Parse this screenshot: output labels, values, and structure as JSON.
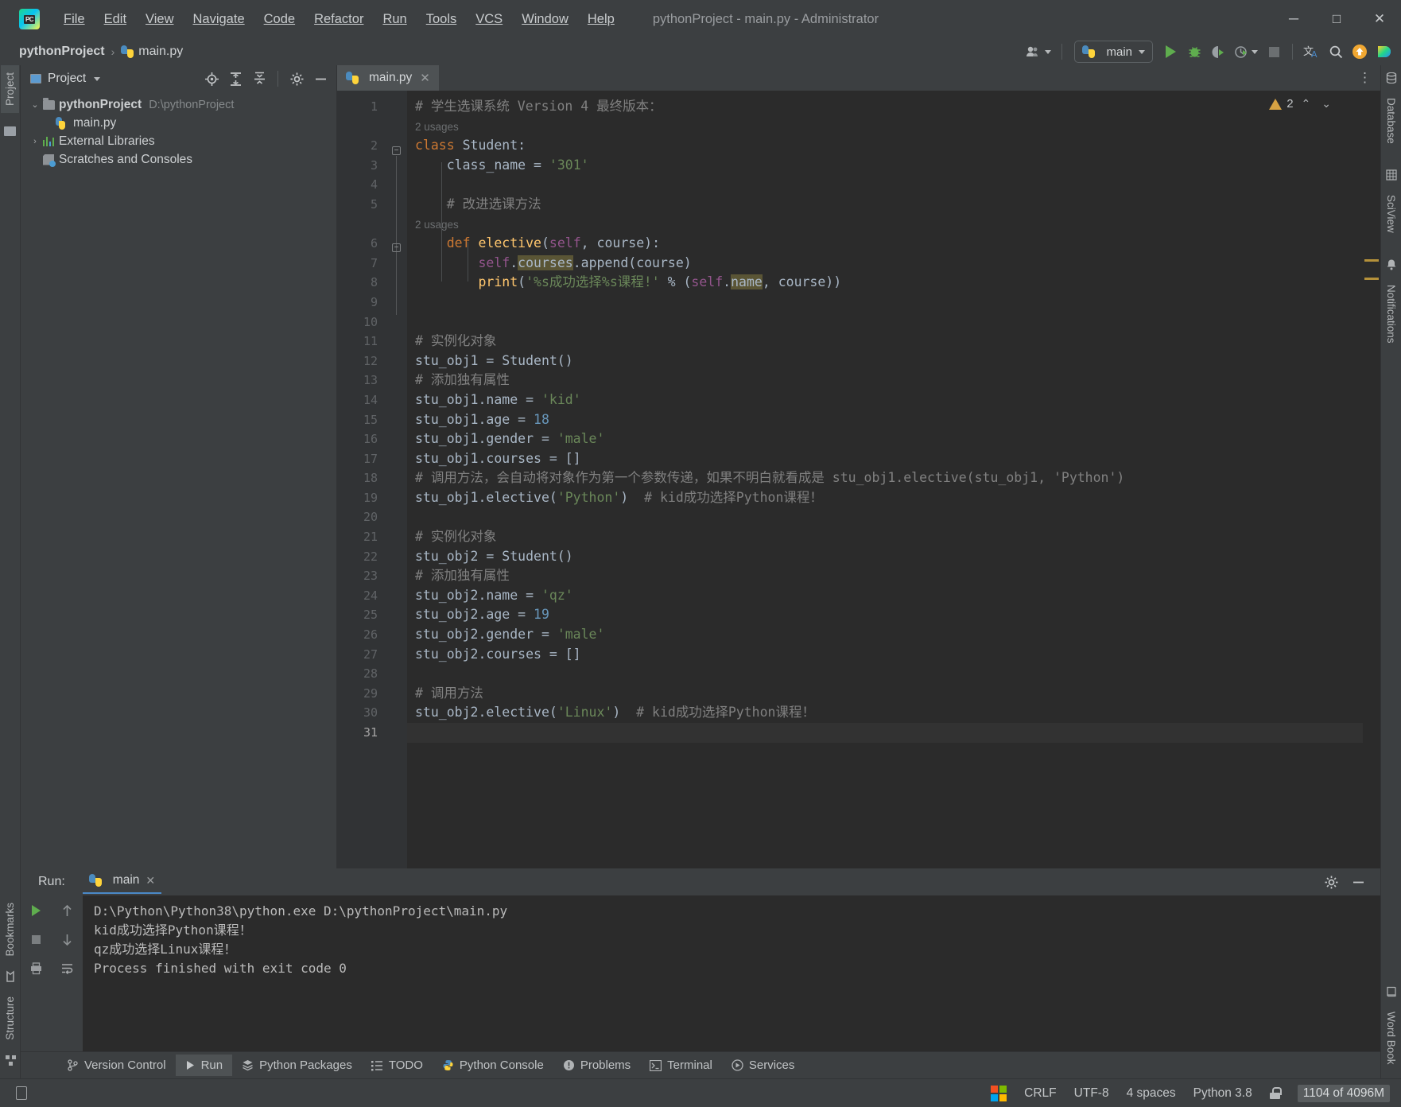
{
  "titlebar": {
    "app_icon": "pycharm-logo-icon",
    "menus": [
      "File",
      "Edit",
      "View",
      "Navigate",
      "Code",
      "Refactor",
      "Run",
      "Tools",
      "VCS",
      "Window",
      "Help"
    ],
    "window_title": "pythonProject - main.py - Administrator",
    "minimize": "─",
    "maximize": "□",
    "close": "✕"
  },
  "navbar": {
    "crumbs": [
      "pythonProject",
      "main.py"
    ],
    "separator": "›",
    "run_config": "main",
    "icons": [
      "user-dropdown-icon",
      "run-icon",
      "debug-icon",
      "coverage-icon",
      "profile-icon",
      "stop-icon",
      "translate-icon",
      "search-icon",
      "update-icon",
      "datalore-icon"
    ]
  },
  "left_strip": {
    "tabs": [
      "Project"
    ],
    "bottom_tabs": [
      "Bookmarks",
      "Structure"
    ]
  },
  "right_strip": {
    "tabs": [
      "Database",
      "SciView",
      "Notifications"
    ],
    "bottom_tabs": [
      "Word Book"
    ]
  },
  "project_panel": {
    "title": "Project",
    "header_icons": [
      "locate-icon",
      "expand-all-icon",
      "collapse-all-icon",
      "settings-icon",
      "hide-icon"
    ],
    "tree": [
      {
        "label": "pythonProject",
        "path": "D:\\pythonProject",
        "icon": "folder-icon",
        "depth": 0,
        "arrow": "⌄",
        "bold": true
      },
      {
        "label": "main.py",
        "path": "",
        "icon": "python-file-icon",
        "depth": 1,
        "arrow": "",
        "bold": false
      },
      {
        "label": "External Libraries",
        "path": "",
        "icon": "libraries-icon",
        "depth": 0,
        "arrow": "›",
        "bold": false
      },
      {
        "label": "Scratches and Consoles",
        "path": "",
        "icon": "scratches-icon",
        "depth": 0,
        "arrow": "",
        "bold": false
      }
    ]
  },
  "editor": {
    "tab": {
      "label": "main.py",
      "icon": "python-file-icon",
      "close": "✕"
    },
    "inspection_count": "2",
    "lines": [
      {
        "n": "1",
        "type": "code",
        "text": "# 学生选课系统 Version 4 最终版本："
      },
      {
        "n": "",
        "type": "usages",
        "text": "2 usages"
      },
      {
        "n": "2",
        "type": "code",
        "text": "class Student:"
      },
      {
        "n": "3",
        "type": "code",
        "text": "    class_name = '301'"
      },
      {
        "n": "4",
        "type": "code",
        "text": ""
      },
      {
        "n": "5",
        "type": "code",
        "text": "    # 改进选课方法"
      },
      {
        "n": "",
        "type": "usages",
        "text": "2 usages"
      },
      {
        "n": "6",
        "type": "code",
        "text": "    def elective(self, course):"
      },
      {
        "n": "7",
        "type": "code",
        "text": "        self.courses.append(course)"
      },
      {
        "n": "8",
        "type": "code",
        "text": "        print('%s成功选择%s课程!' % (self.name, course))"
      },
      {
        "n": "9",
        "type": "code",
        "text": ""
      },
      {
        "n": "10",
        "type": "code",
        "text": ""
      },
      {
        "n": "11",
        "type": "code",
        "text": "# 实例化对象"
      },
      {
        "n": "12",
        "type": "code",
        "text": "stu_obj1 = Student()"
      },
      {
        "n": "13",
        "type": "code",
        "text": "# 添加独有属性"
      },
      {
        "n": "14",
        "type": "code",
        "text": "stu_obj1.name = 'kid'"
      },
      {
        "n": "15",
        "type": "code",
        "text": "stu_obj1.age = 18"
      },
      {
        "n": "16",
        "type": "code",
        "text": "stu_obj1.gender = 'male'"
      },
      {
        "n": "17",
        "type": "code",
        "text": "stu_obj1.courses = []"
      },
      {
        "n": "18",
        "type": "code",
        "text": "# 调用方法，会自动将对象作为第一个参数传递，如果不明白就看成是 stu_obj1.elective(stu_obj1, 'Python')"
      },
      {
        "n": "19",
        "type": "code",
        "text": "stu_obj1.elective('Python')  # kid成功选择Python课程！"
      },
      {
        "n": "20",
        "type": "code",
        "text": ""
      },
      {
        "n": "21",
        "type": "code",
        "text": "# 实例化对象"
      },
      {
        "n": "22",
        "type": "code",
        "text": "stu_obj2 = Student()"
      },
      {
        "n": "23",
        "type": "code",
        "text": "# 添加独有属性"
      },
      {
        "n": "24",
        "type": "code",
        "text": "stu_obj2.name = 'qz'"
      },
      {
        "n": "25",
        "type": "code",
        "text": "stu_obj2.age = 19"
      },
      {
        "n": "26",
        "type": "code",
        "text": "stu_obj2.gender = 'male'"
      },
      {
        "n": "27",
        "type": "code",
        "text": "stu_obj2.courses = []"
      },
      {
        "n": "28",
        "type": "code",
        "text": ""
      },
      {
        "n": "29",
        "type": "code",
        "text": "# 调用方法"
      },
      {
        "n": "30",
        "type": "code",
        "text": "stu_obj2.elective('Linux')  # kid成功选择Python课程！"
      },
      {
        "n": "31",
        "type": "code",
        "text": ""
      }
    ]
  },
  "run_panel": {
    "label": "Run:",
    "tab": "main",
    "tab_close": "✕",
    "side_icons": [
      "rerun-icon",
      "up-icon",
      "down-icon",
      "settings-wrench-icon",
      "stop-icon",
      "soft-wrap-icon",
      "print-icon"
    ],
    "header_icons": [
      "settings-icon",
      "hide-icon"
    ],
    "console_lines": [
      "D:\\Python\\Python38\\python.exe D:\\pythonProject\\main.py",
      "kid成功选择Python课程！",
      "qz成功选择Linux课程！",
      "",
      "Process finished with exit code 0"
    ]
  },
  "bottom_toolbar": {
    "items": [
      {
        "label": "Version Control",
        "icon": "branch-icon",
        "active": false
      },
      {
        "label": "Run",
        "icon": "play-icon",
        "active": true
      },
      {
        "label": "Python Packages",
        "icon": "packages-icon",
        "active": false
      },
      {
        "label": "TODO",
        "icon": "list-icon",
        "active": false
      },
      {
        "label": "Python Console",
        "icon": "python-icon",
        "active": false
      },
      {
        "label": "Problems",
        "icon": "warning-icon",
        "active": false
      },
      {
        "label": "Terminal",
        "icon": "terminal-icon",
        "active": false
      },
      {
        "label": "Services",
        "icon": "services-icon",
        "active": false
      }
    ]
  },
  "statusbar": {
    "left_icon": "show-hide-toolwindows-icon",
    "line_separator": "CRLF",
    "encoding": "UTF-8",
    "indent": "4 spaces",
    "interpreter": "Python 3.8",
    "lock_icon": "unlocked-icon",
    "memory": "1104 of 4096M",
    "os_icon": "windows-icon"
  },
  "colors": {
    "bg_chrome": "#3c3f41",
    "bg_editor": "#2b2b2b",
    "bg_gutter": "#313335",
    "accent_blue": "#4a88c7",
    "green_run": "#5fad4e",
    "warn_yellow": "#d6a243",
    "string_green": "#6a8759",
    "keyword_orange": "#cc7832",
    "number_blue": "#6897bb",
    "comment_gray": "#808080",
    "func_yellow": "#ffc66d",
    "self_purple": "#94558d"
  }
}
